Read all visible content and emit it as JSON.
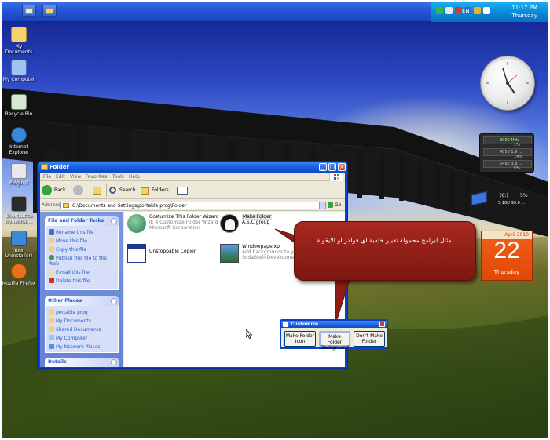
{
  "taskbar": {
    "language": "EN",
    "time": "11:17 PM",
    "day": "Thursday"
  },
  "desktop_icons": [
    {
      "label": "My Documents",
      "icon": "folder-documents-icon",
      "color": "#f3d26b"
    },
    {
      "label": "My Computer",
      "icon": "computer-icon",
      "color": "#9ec3f0"
    },
    {
      "label": "Recycle Bin",
      "icon": "recycle-bin-icon",
      "color": "#d7e8d2"
    },
    {
      "label": "Internet Explorer",
      "icon": "ie-icon",
      "color": "#3a86d8"
    },
    {
      "label": "Pidgin 9",
      "icon": "pidgin-icon",
      "color": "#e8e8e8"
    },
    {
      "label": "Shortcut to minenna ...",
      "icon": "shortcut-icon",
      "color": "#2a2a2a"
    },
    {
      "label": "Your Uninstaller!",
      "icon": "uninstaller-icon",
      "color": "#3a8ad8"
    },
    {
      "label": "Mozilla Firefox",
      "icon": "firefox-icon",
      "color": "#e8701a"
    }
  ],
  "gadgets": {
    "cpu": {
      "freq": "3000 MHz",
      "cpu_pct": "1%",
      "ram": "405 / 1.9 ...",
      "ram_pct": "14%",
      "swap": "549 / 3.8 ...",
      "swap_pct": "5%"
    },
    "drive": {
      "letter": "(C:)",
      "pct": "5%",
      "size": "5.1G / 99.0 ..."
    },
    "calendar": {
      "month_year": "April 2010",
      "date": "22",
      "weekday": "Thursday"
    }
  },
  "window": {
    "title": "Folder",
    "menu": [
      "File",
      "Edit",
      "View",
      "Favorites",
      "Tools",
      "Help"
    ],
    "toolbar": {
      "back": "Back",
      "search": "Search",
      "folders": "Folders"
    },
    "address": {
      "label": "Address",
      "value": "C:\\Documents and Settings\\portable prog\\Folder",
      "go": "Go"
    },
    "tasks": {
      "title": "File and Folder Tasks",
      "items": [
        "Rename this file",
        "Move this file",
        "Copy this file",
        "Publish this file to the Web",
        "E-mail this file",
        "Delete this file"
      ]
    },
    "other_places": {
      "title": "Other Places",
      "items": [
        "portable prog",
        "My Documents",
        "Shared Documents",
        "My Computer",
        "My Network Places"
      ]
    },
    "details": {
      "title": "Details"
    },
    "files": [
      {
        "name": "Costumize This Folder Wizard",
        "line2": "IE 4 Customize Folder Wizard",
        "line3": "Microsoft Corporation",
        "icon": "globe-icon"
      },
      {
        "name": "Make Folder",
        "line2": "A.S.C group",
        "line3": "",
        "icon": "ghost-icon"
      },
      {
        "name": "Unstoppable Copier",
        "line2": "",
        "line3": "",
        "icon": "app-window-icon"
      },
      {
        "name": "Windowpape xp",
        "line2": "Add backgrounds to yo...",
        "line3": "SodaBush Development",
        "icon": "wallpaper-icon"
      }
    ]
  },
  "dialog": {
    "title": "Customize",
    "buttons": [
      "Make Folder Icon",
      "Make Folder Background",
      "Don't Make Folder"
    ]
  },
  "callout": {
    "text": "مثال لبرامج محمولة تغيير خلفية اي فولدر او الايقونة"
  }
}
